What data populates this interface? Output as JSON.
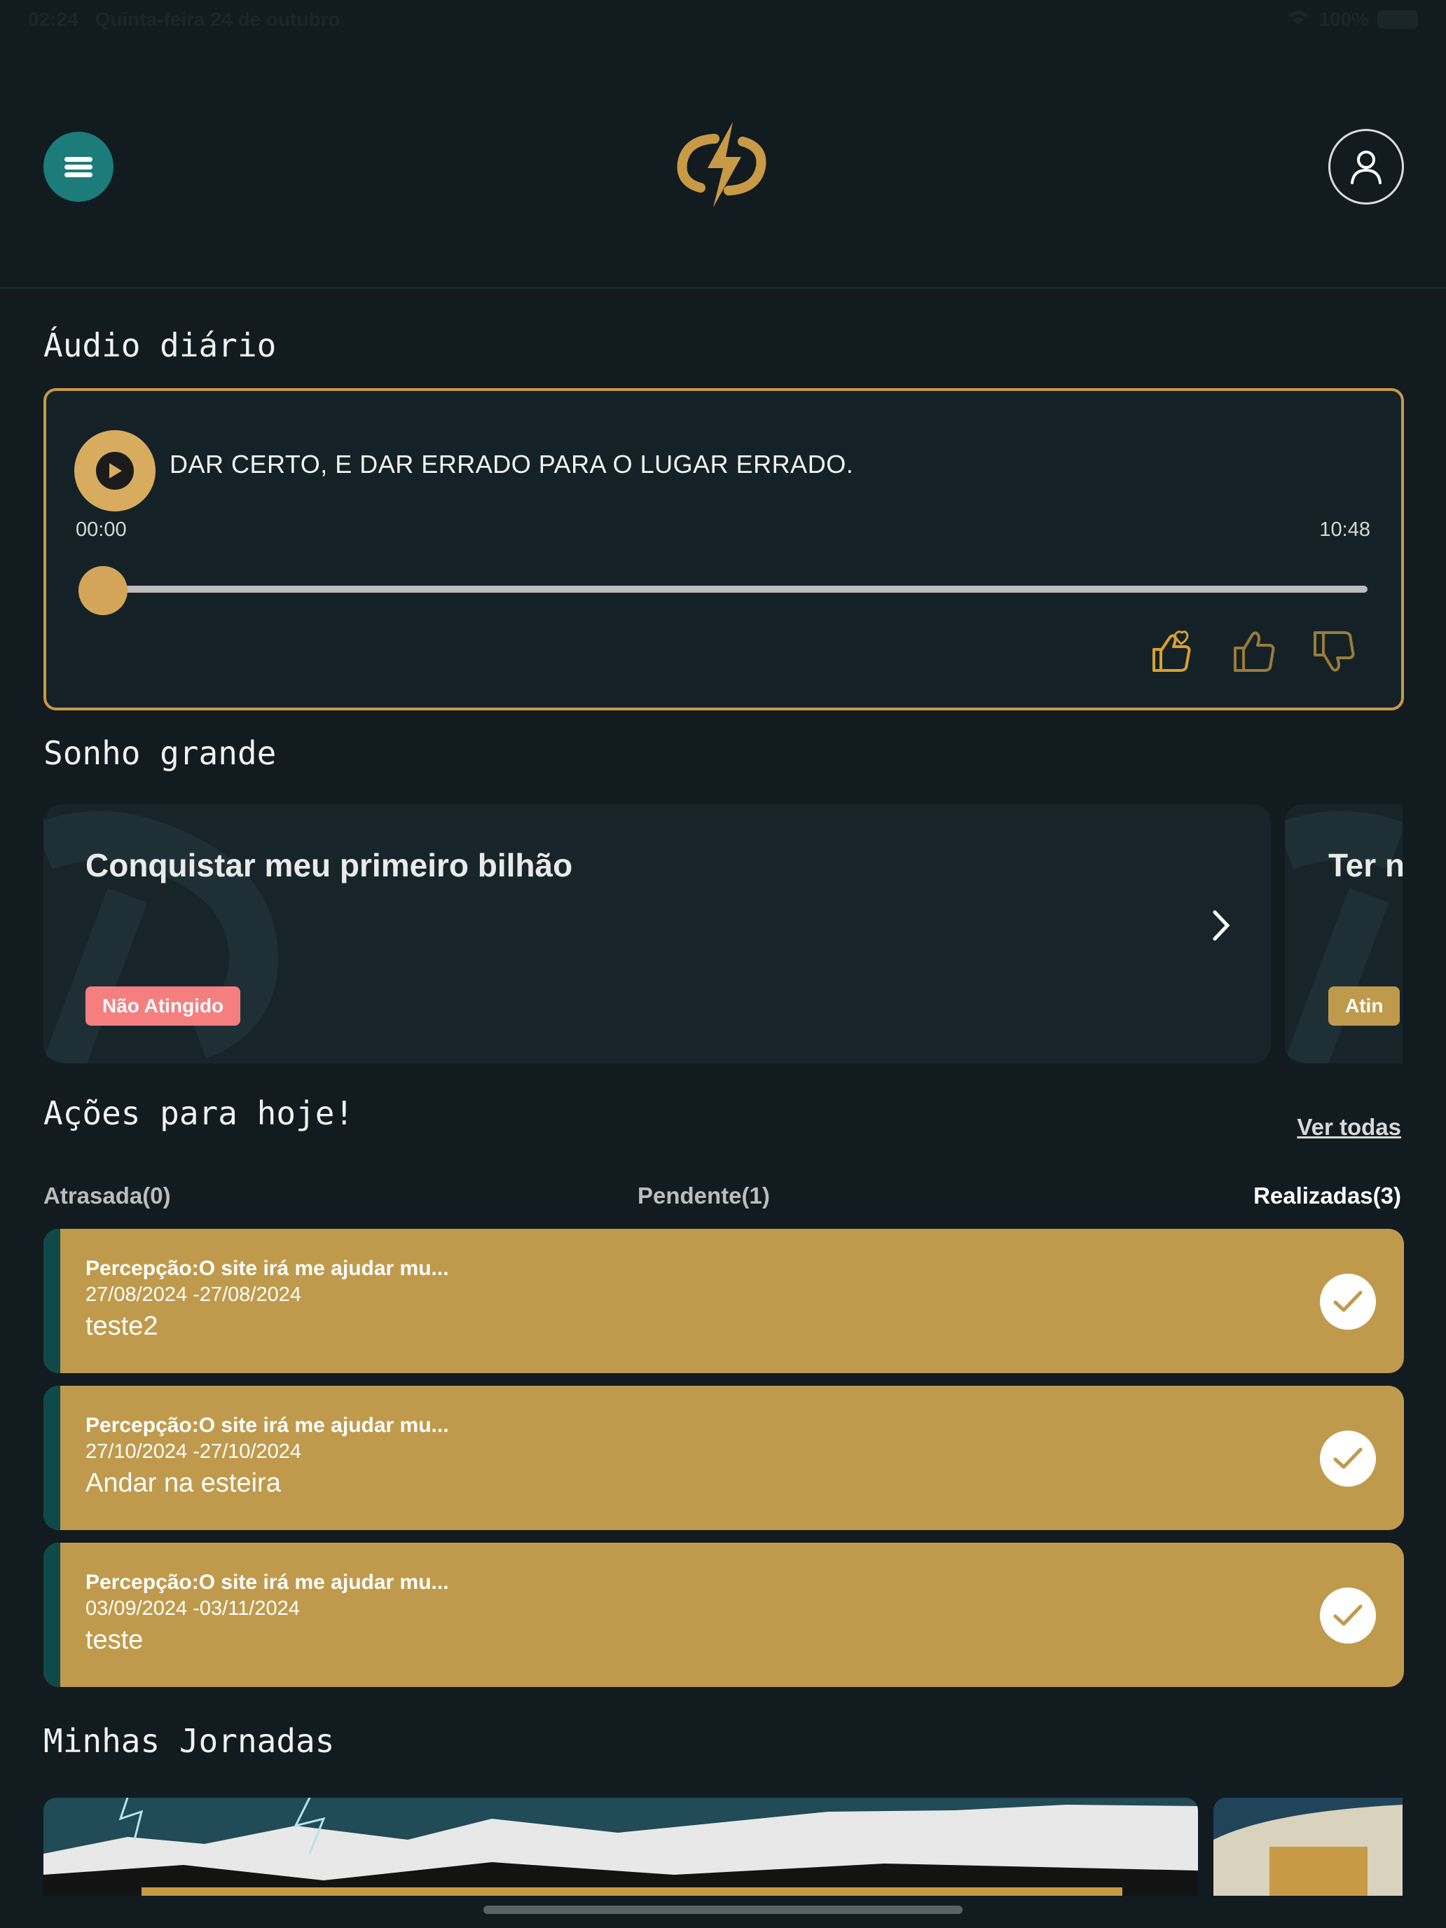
{
  "status_bar": {
    "time": "02:24",
    "date": "Quinta-feira 24 de outubro",
    "battery": "100%"
  },
  "header": {
    "menu_icon": "hamburger-icon",
    "logo_icon": "bolt-logo",
    "profile_icon": "user-icon"
  },
  "audio": {
    "section_title": "Áudio diário",
    "title": "DAR CERTO, E DAR ERRADO PARA O LUGAR ERRADO.",
    "current_time": "00:00",
    "duration": "10:48",
    "progress": 0,
    "reactions": [
      "love-hand-icon",
      "thumbs-up-icon",
      "thumbs-down-icon"
    ],
    "accent": "#c89a45"
  },
  "dream": {
    "section_title": "Sonho grande",
    "cards": [
      {
        "title": "Conquistar meu primeiro bilhão",
        "status": "Não Atingido",
        "status_color": "#f57f7f"
      },
      {
        "title": "Ter n",
        "status": "Atin",
        "status_color": "#c09a4c"
      }
    ]
  },
  "actions": {
    "section_title": "Ações para hoje!",
    "see_all": "Ver todas",
    "tabs": [
      "Atrasada(0)",
      "Pendente(1)",
      "Realizadas(3)"
    ],
    "active_tab": 2,
    "items": [
      {
        "goal": "Percepção:O site irá me ajudar mu...",
        "dates": "27/08/2024 -27/08/2024",
        "name": "teste2"
      },
      {
        "goal": "Percepção:O site irá me ajudar mu...",
        "dates": "27/10/2024 -27/10/2024",
        "name": "Andar na esteira"
      },
      {
        "goal": "Percepção:O site irá me ajudar mu...",
        "dates": "03/09/2024 -03/11/2024",
        "name": "teste"
      }
    ]
  },
  "journeys": {
    "section_title": "Minhas Jornadas"
  }
}
